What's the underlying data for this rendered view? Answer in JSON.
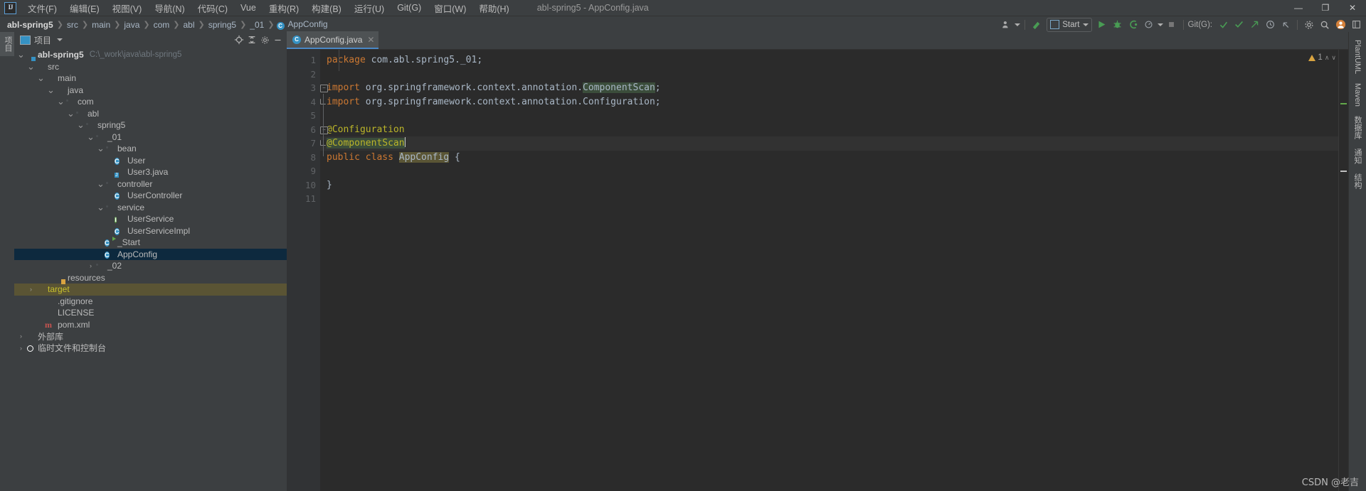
{
  "window": {
    "title": "abl-spring5 - AppConfig.java",
    "logo": "intellij-idea-logo",
    "minimize": "—",
    "maximize": "❐",
    "close": "✕"
  },
  "menu": [
    {
      "label": "文件(F)"
    },
    {
      "label": "编辑(E)"
    },
    {
      "label": "视图(V)"
    },
    {
      "label": "导航(N)"
    },
    {
      "label": "代码(C)"
    },
    {
      "label": "Vue"
    },
    {
      "label": "重构(R)"
    },
    {
      "label": "构建(B)"
    },
    {
      "label": "运行(U)"
    },
    {
      "label": "Git(G)"
    },
    {
      "label": "窗口(W)"
    },
    {
      "label": "帮助(H)"
    }
  ],
  "breadcrumb": [
    {
      "label": "abl-spring5",
      "root": true
    },
    {
      "label": "src"
    },
    {
      "label": "main"
    },
    {
      "label": "java"
    },
    {
      "label": "com"
    },
    {
      "label": "abl"
    },
    {
      "label": "spring5"
    },
    {
      "label": "_01"
    },
    {
      "label": "AppConfig",
      "icon": "C"
    }
  ],
  "toolbar": {
    "run_config": "Start",
    "git_label": "Git(G):",
    "icons": {
      "profiler": "profiler-icon",
      "build": "build-hammer-icon",
      "run": "run-icon",
      "debug": "debug-icon",
      "coverage": "coverage-icon",
      "more": "more-icon",
      "stop": "stop-icon",
      "update": "git-update-icon",
      "commit": "git-commit-icon",
      "push": "git-push-icon",
      "history": "history-icon",
      "back": "jump-back-icon",
      "settings": "settings-gear-icon",
      "search": "search-icon",
      "account": "user-account-icon",
      "layout": "layout-icon"
    }
  },
  "project_panel": {
    "title": "项目",
    "dropdown": "chevron-down",
    "locate_icon": "locate-target-icon",
    "collapse_icon": "collapse-all-icon",
    "settings_icon": "gear-icon",
    "hide_icon": "hide-icon",
    "tree": [
      {
        "label": "abl-spring5",
        "path": "C:\\_work\\java\\abl-spring5",
        "indent": 0,
        "arrow": "v",
        "icon": "module",
        "bold": true
      },
      {
        "label": "src",
        "indent": 1,
        "arrow": "v",
        "icon": "folder"
      },
      {
        "label": "main",
        "indent": 2,
        "arrow": "v",
        "icon": "folder"
      },
      {
        "label": "java",
        "indent": 3,
        "arrow": "v",
        "icon": "source-folder"
      },
      {
        "label": "com",
        "indent": 4,
        "arrow": "v",
        "icon": "package"
      },
      {
        "label": "abl",
        "indent": 5,
        "arrow": "v",
        "icon": "package"
      },
      {
        "label": "spring5",
        "indent": 6,
        "arrow": "v",
        "icon": "package"
      },
      {
        "label": "_01",
        "indent": 7,
        "arrow": "v",
        "icon": "package"
      },
      {
        "label": "bean",
        "indent": 8,
        "arrow": "v",
        "icon": "package"
      },
      {
        "label": "User",
        "indent": 9,
        "arrow": "",
        "icon": "class"
      },
      {
        "label": "User3.java",
        "indent": 9,
        "arrow": "",
        "icon": "java-file"
      },
      {
        "label": "controller",
        "indent": 8,
        "arrow": "v",
        "icon": "package"
      },
      {
        "label": "UserController",
        "indent": 9,
        "arrow": "",
        "icon": "class"
      },
      {
        "label": "service",
        "indent": 8,
        "arrow": "v",
        "icon": "package"
      },
      {
        "label": "UserService",
        "indent": 9,
        "arrow": "",
        "icon": "interface"
      },
      {
        "label": "UserServiceImpl",
        "indent": 9,
        "arrow": "",
        "icon": "class"
      },
      {
        "label": "_Start",
        "indent": 8,
        "arrow": "",
        "icon": "runnable-class"
      },
      {
        "label": "AppConfig",
        "indent": 8,
        "arrow": "",
        "icon": "class",
        "selected": true
      },
      {
        "label": "_02",
        "indent": 7,
        "arrow": ">",
        "icon": "package"
      },
      {
        "label": "resources",
        "indent": 3,
        "arrow": "",
        "icon": "resource-folder"
      },
      {
        "label": "target",
        "indent": 1,
        "arrow": ">",
        "icon": "target-folder",
        "excluded": true
      },
      {
        "label": ".gitignore",
        "indent": 2,
        "arrow": "",
        "icon": "gitignore-file"
      },
      {
        "label": "LICENSE",
        "indent": 2,
        "arrow": "",
        "icon": "text-file"
      },
      {
        "label": "pom.xml",
        "indent": 2,
        "arrow": "",
        "icon": "maven-file"
      },
      {
        "label": "外部库",
        "indent": 0,
        "arrow": ">",
        "icon": "library"
      },
      {
        "label": "临时文件和控制台",
        "indent": 0,
        "arrow": ">",
        "icon": "console"
      }
    ]
  },
  "editor": {
    "tab": {
      "name": "AppConfig.java",
      "icon": "C",
      "close": "✕"
    },
    "inspection": {
      "warning_count": "1",
      "up": "∧",
      "down": "∨"
    },
    "lines": [
      {
        "n": "1",
        "tokens": [
          {
            "t": "package ",
            "c": "k"
          },
          {
            "t": "com.abl.spring5._01;",
            "c": "pkgnm"
          }
        ]
      },
      {
        "n": "2",
        "tokens": []
      },
      {
        "n": "3",
        "fold": "minus",
        "tokens": [
          {
            "t": "import ",
            "c": "k"
          },
          {
            "t": "org.springframework.context.annotation.",
            "c": "cls"
          },
          {
            "t": "ComponentScan",
            "c": "annmatch"
          },
          {
            "t": ";",
            "c": "cls"
          }
        ]
      },
      {
        "n": "4",
        "fold": "corner",
        "tokens": [
          {
            "t": "import ",
            "c": "k"
          },
          {
            "t": "org.springframework.context.annotation.Configuration;",
            "c": "cls"
          }
        ]
      },
      {
        "n": "5",
        "tokens": []
      },
      {
        "n": "6",
        "fold": "minus",
        "tokens": [
          {
            "t": "@Configuration",
            "c": "ann"
          }
        ]
      },
      {
        "n": "7",
        "fold": "corner",
        "gutter_mark": "bean-marker",
        "caret": true,
        "highlight": true,
        "tokens": [
          {
            "t": "@ComponentScan",
            "c": "ann annmatch"
          }
        ]
      },
      {
        "n": "8",
        "gutter_mark": "spring-marker",
        "tokens": [
          {
            "t": "public class ",
            "c": "k"
          },
          {
            "t": "AppConfig",
            "c": "idhl"
          },
          {
            "t": " {",
            "c": "cls"
          }
        ]
      },
      {
        "n": "9",
        "tokens": []
      },
      {
        "n": "10",
        "tokens": [
          {
            "t": "}",
            "c": "cls"
          }
        ]
      },
      {
        "n": "11",
        "tokens": []
      }
    ]
  },
  "left_strip": [
    {
      "label": "项目",
      "selected": true
    }
  ],
  "right_strip": [
    {
      "label": "PlantUML"
    },
    {
      "label": "Maven"
    },
    {
      "label": "数据库"
    },
    {
      "label": "通知"
    },
    {
      "label": "结构"
    }
  ],
  "watermark": "CSDN @老吉"
}
